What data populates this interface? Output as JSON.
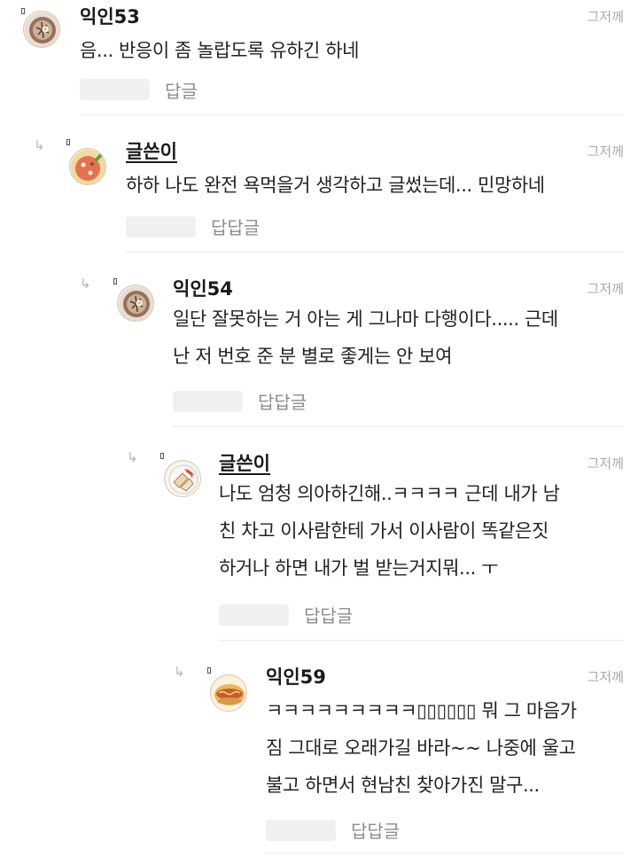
{
  "comments": [
    {
      "nickname": "익인53",
      "time": "그저께",
      "lines": [
        "음... 반응이 좀 놀랍도록 유하긴 하네"
      ],
      "reply_label": "답글",
      "avatar": "bibimbap-avatar-icon"
    },
    {
      "nickname": "글쓴이",
      "time": "그저께",
      "lines": [
        "하하 나도 완전 욕먹을거 생각하고 글썼는데... 민망하네"
      ],
      "reply_label": "답답글",
      "avatar": "pizza-bowl-avatar-icon"
    },
    {
      "nickname": "익인54",
      "time": "그저께",
      "lines": [
        "일단 잘못하는 거 아는 게 그나마 다행이다..... 근데",
        "난 저 번호 준 분 별로 좋게는 안 보여"
      ],
      "reply_label": "답답글",
      "avatar": "bibimbap-avatar-icon"
    },
    {
      "nickname": "글쓴이",
      "time": "그저께",
      "lines": [
        "나도 엄청 의아하긴해..ㅋㅋㅋㅋ 근데 내가 남",
        "친 차고 이사람한테 가서 이사람이 똑같은짓",
        "하거나 하면 내가 벌 받는거지뭐... ㅜ"
      ],
      "reply_label": "답답글",
      "avatar": "sashimi-plate-avatar-icon"
    },
    {
      "nickname": "익인59",
      "time": "그저께",
      "lines": [
        "ㅋㅋㅋㅋㅋㅋㅋㅋㅋ▯▯▯▯▯▯ 뭐 그 마음가",
        "짐 그대로 오래가길 바라~~ 나중에 울고",
        "불고 하면서 현남친 찾아가진 말구..."
      ],
      "reply_label": "답답글",
      "avatar": "hotdog-avatar-icon"
    }
  ],
  "icons": {
    "reply_arrow": "reply-arrow-icon",
    "arrow_glyph": "↳"
  }
}
